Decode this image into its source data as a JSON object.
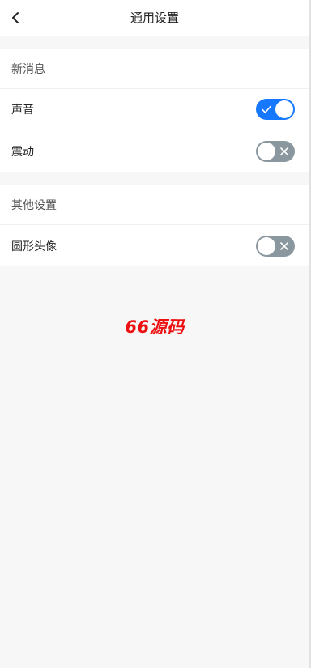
{
  "header": {
    "title": "通用设置",
    "back_icon": "chevron-left-icon"
  },
  "sections": [
    {
      "title": "新消息",
      "items": [
        {
          "label": "声音",
          "enabled": true
        },
        {
          "label": "震动",
          "enabled": false
        }
      ]
    },
    {
      "title": "其他设置",
      "items": [
        {
          "label": "圆形头像",
          "enabled": false
        }
      ]
    }
  ],
  "watermark": "66源码",
  "colors": {
    "toggle_on": "#1677ff",
    "toggle_off": "#8a979f",
    "watermark": "#ee1111",
    "background": "#f7f7f7"
  }
}
